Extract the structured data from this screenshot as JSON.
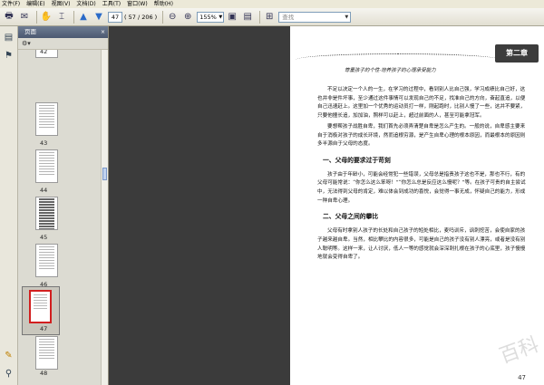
{
  "menu": [
    "文件(F)",
    "编辑(E)",
    "视图(V)",
    "文档(D)",
    "工具(T)",
    "窗口(W)",
    "帮助(H)"
  ],
  "toolbar": {
    "page_current": "47",
    "page_total": "( 57 / 206 )",
    "zoom": "155%",
    "search_placeholder": "查找"
  },
  "panel": {
    "title": "页面",
    "close": "×"
  },
  "thumbnails": [
    {
      "num": "42"
    },
    {
      "num": "43"
    },
    {
      "num": "44"
    },
    {
      "num": "45"
    },
    {
      "num": "46"
    },
    {
      "num": "47"
    },
    {
      "num": "48"
    }
  ],
  "document": {
    "chapter_tab": "第二章",
    "running_head": "尊重孩子的个性·培养孩子的心理承受能力",
    "paragraphs": [
      "不足以决定一个人的一生，在学习的过程中，看到别人比自己强，学习成绩比自己好，这也并非是件坏事，至少通过这件事情可以发现自己的不足，找准自己的方向，奋起直追，以便自己迅速赶上。这里加一个优秀的运动员打一样，刚起跑时，比别人慢了一些，这并不要紧，只要他擅长追，加加油，照样可以赶上，超过前面的人，甚至可能拿冠军。",
      "要想帮孩子战胜自卑，我们首先必须弄清楚自卑是怎么产生的。一般的说，自卑感主要来自于消极对孩子的成长环境，然而追根穷源，是产生自卑心理的根本原因，而最根本的原因则多半源自于父母的态度。"
    ],
    "heading1": "一、父母的要求过于苛刻",
    "paragraphs2": [
      "孩子由于年龄小，可能会经常犯一些错误，父母总是指责孩子这也不是，那也不行，有的父母可能常说：“你怎么这么笨呀！”“你怎么总是反应这么慢呢？”等。在孩子可贵的自主尝试中，无法得到父母的肯定，难以体会到成功的喜悦，会觉得一事无成，怀疑自己的能力，形成一种自卑心理。"
    ],
    "heading2": "二、父母之间的攀比",
    "paragraphs3": [
      "父母有时拿别人孩子的长处和自己孩子的短处相比，麦吗训斥，讽刺挖苦，会使自家的孩子越来越自卑。当然，相比攀比的内容很多，可能是自己的孩子没有别人漂亮，或者是没有别人聪明等。这样一来，让人讨厌，低人一等的感觉就会深深刺扎根在孩子的心底里，孩子慢慢地就会变得自卑了。"
    ],
    "page_number": "47",
    "watermark": "百科"
  }
}
